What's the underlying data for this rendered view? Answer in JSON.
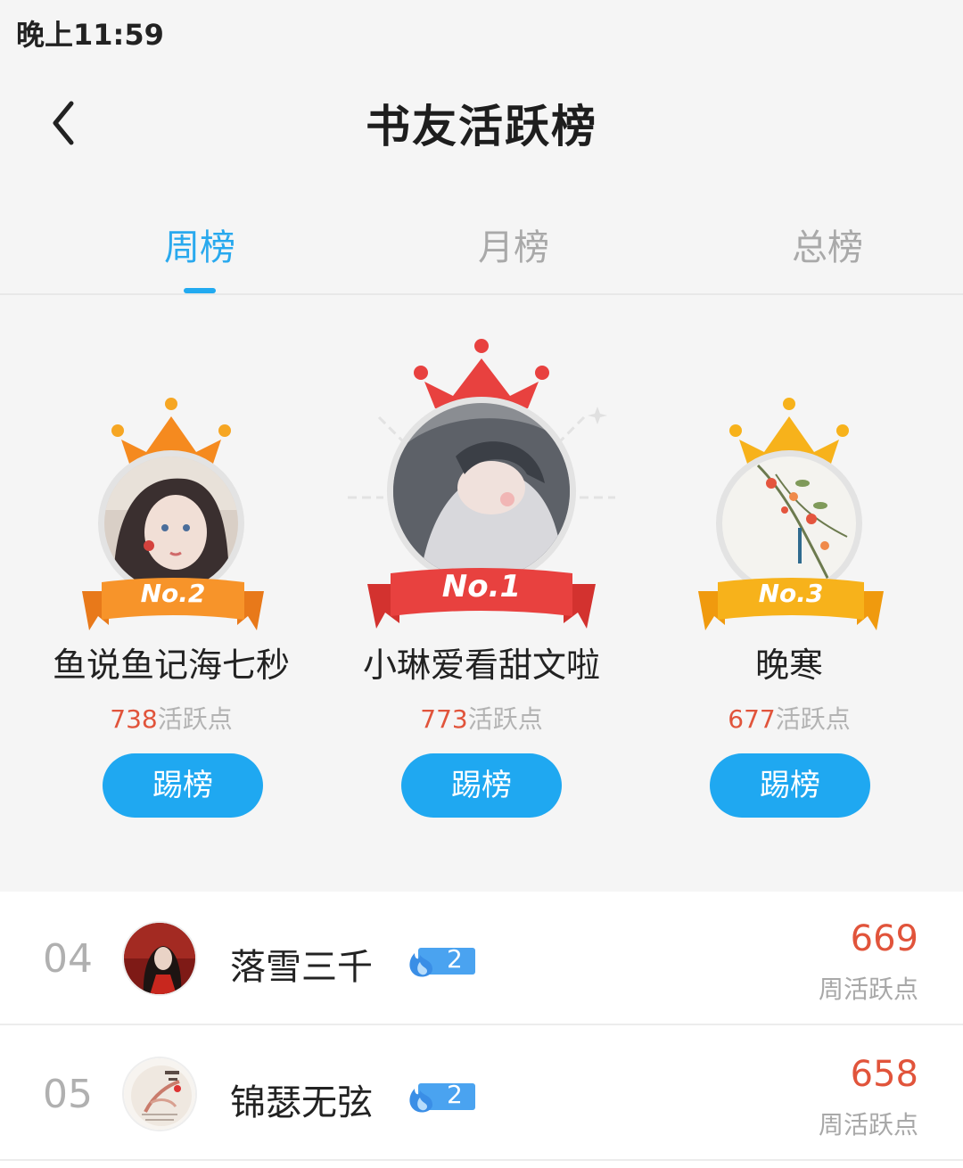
{
  "status_bar": {
    "time": "晚上11:59"
  },
  "header": {
    "title": "书友活跃榜"
  },
  "tabs": [
    {
      "label": "周榜",
      "active": true
    },
    {
      "label": "月榜",
      "active": false
    },
    {
      "label": "总榜",
      "active": false
    }
  ],
  "podium": {
    "second": {
      "rank_label": "No.2",
      "name": "鱼说鱼记海七秒",
      "points": "738",
      "points_suffix": "活跃点",
      "button": "踢榜"
    },
    "first": {
      "rank_label": "No.1",
      "name": "小琳爱看甜文啦",
      "points": "773",
      "points_suffix": "活跃点",
      "button": "踢榜"
    },
    "third": {
      "rank_label": "No.3",
      "name": "晚寒",
      "points": "677",
      "points_suffix": "活跃点",
      "button": "踢榜"
    }
  },
  "list": [
    {
      "rank": "04",
      "name": "落雪三千",
      "badge_level": "2",
      "score": "669",
      "score_label": "周活跃点"
    },
    {
      "rank": "05",
      "name": "锦瑟无弦",
      "badge_level": "2",
      "score": "658",
      "score_label": "周活跃点"
    }
  ],
  "colors": {
    "accent": "#22aaf0",
    "points": "#e1543b",
    "gold": "#f7a21b",
    "red": "#e8413f",
    "orange": "#f58a1f"
  },
  "icons": {
    "back": "chevron-left-icon",
    "crown": "crown-icon",
    "badge": "flame-level-icon"
  }
}
